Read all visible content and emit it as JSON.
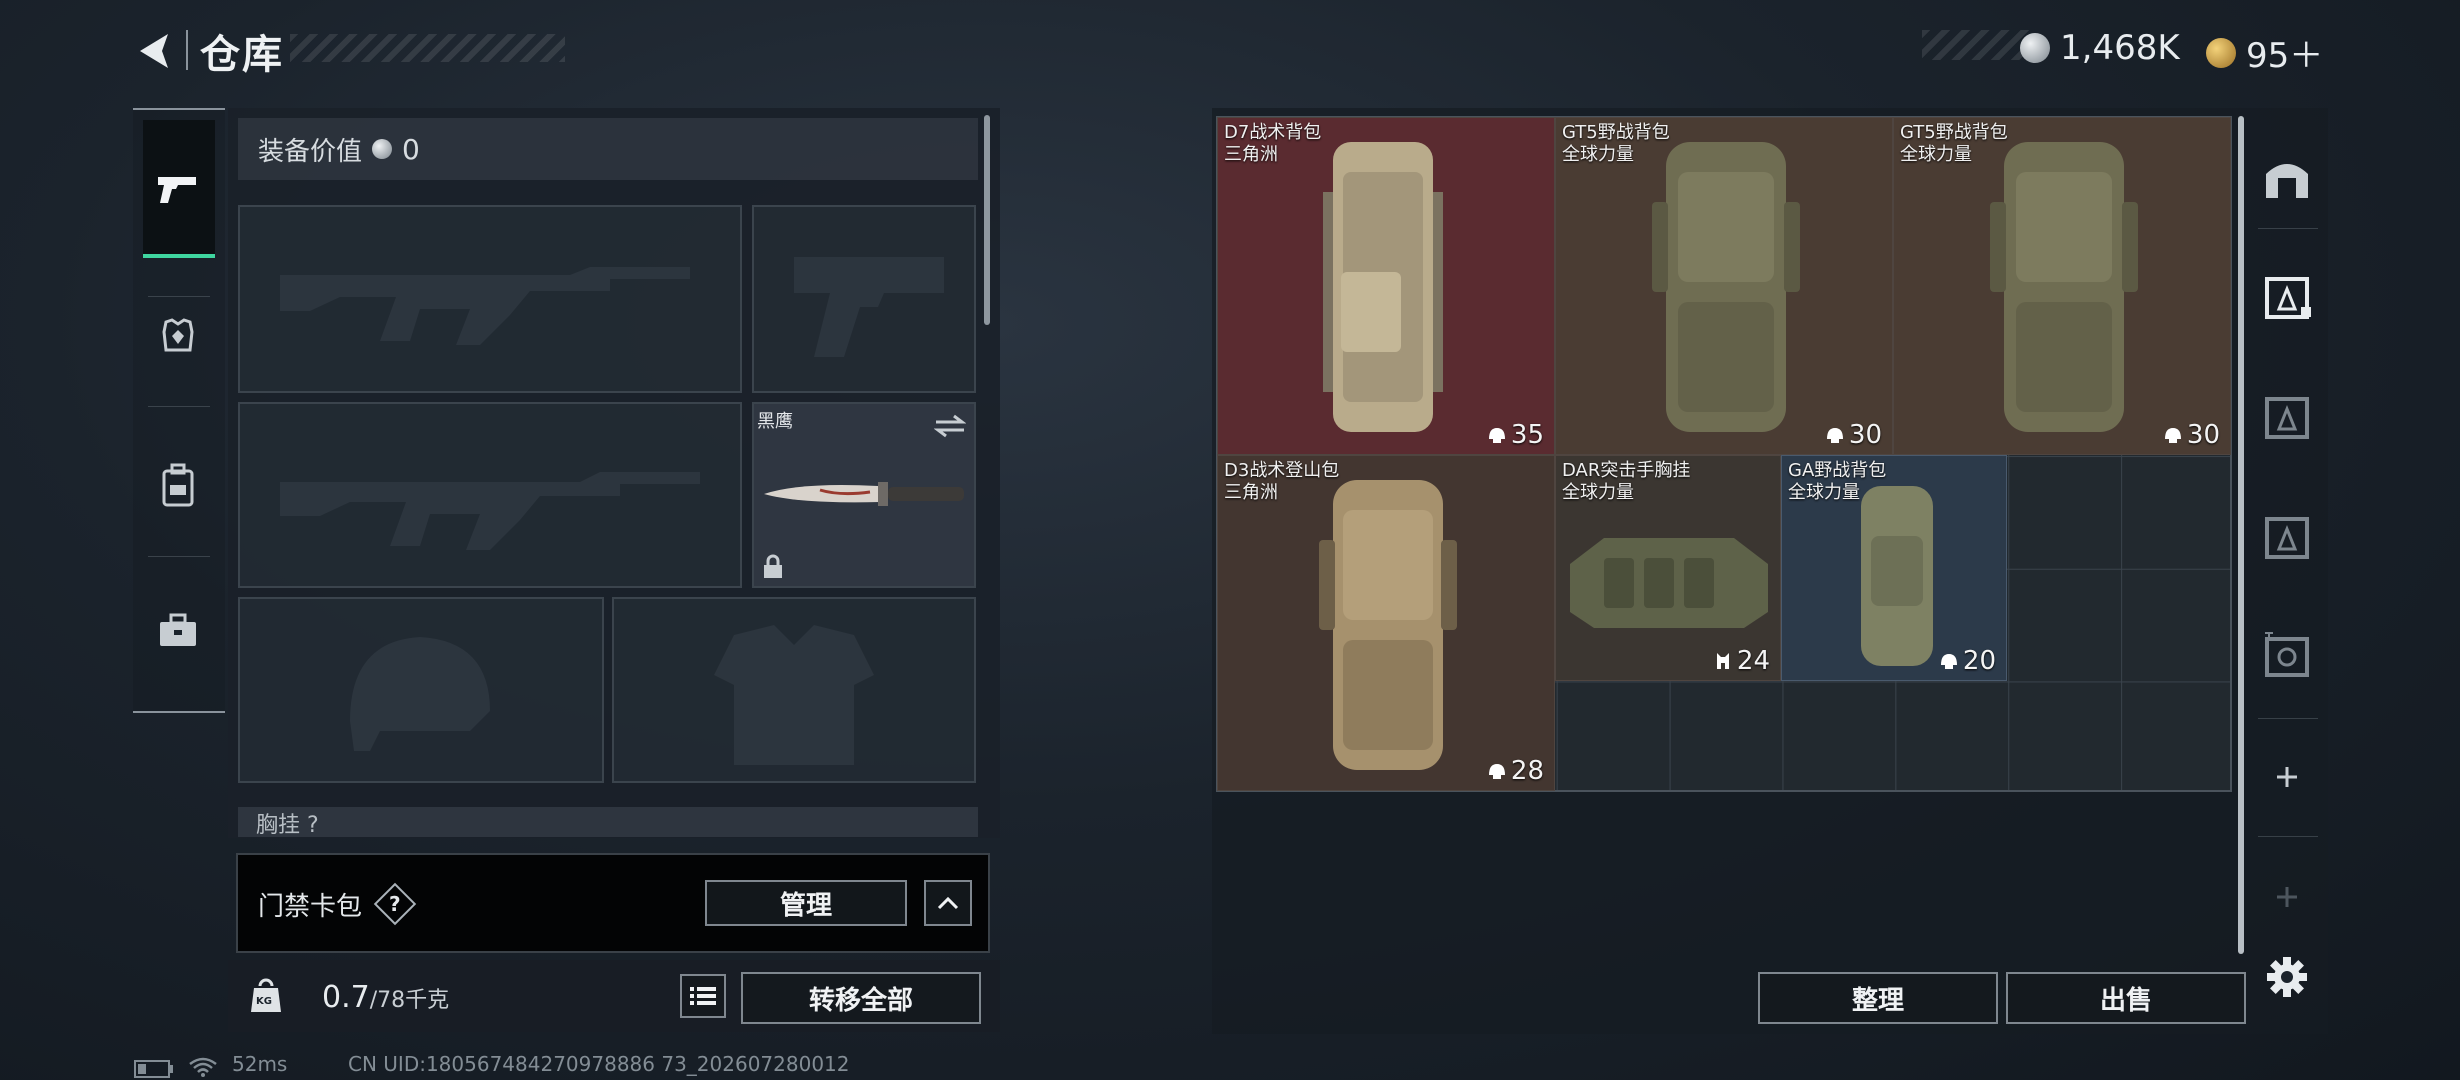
{
  "header": {
    "title": "仓库"
  },
  "currency": {
    "primary": "1,468K",
    "secondary": "95＋",
    "primary_color": "#bfc6cc",
    "secondary_color": "#d8a84a"
  },
  "left_tabs": [
    {
      "icon": "pistol-icon",
      "active": true
    },
    {
      "icon": "armor-icon",
      "active": false
    },
    {
      "icon": "backpack-icon",
      "active": false
    },
    {
      "icon": "briefcase-icon",
      "active": false
    }
  ],
  "equipment": {
    "value_label": "装备价值",
    "value": "0",
    "knife_name": "黑鹰",
    "partial_row_label": "胸挂 ?",
    "card_bag_label": "门禁卡包",
    "card_bag_help": "?",
    "manage_button": "管理"
  },
  "carry": {
    "weight_value": "0.7",
    "weight_max": "/78千克",
    "kg_icon_text": "KG",
    "transfer_all": "转移全部"
  },
  "storage": {
    "items": [
      {
        "name": "D7战术背包",
        "source": "三角洲",
        "capacity": "35",
        "cap_icon": "helmet-icon",
        "color": "#5a2b30"
      },
      {
        "name": "GT5野战背包",
        "source": "全球力量",
        "capacity": "30",
        "cap_icon": "helmet-icon",
        "color": "#4a3c33"
      },
      {
        "name": "GT5野战背包",
        "source": "全球力量",
        "capacity": "30",
        "cap_icon": "helmet-icon",
        "color": "#4a3c33"
      },
      {
        "name": "D3战术登山包",
        "source": "三角洲",
        "capacity": "28",
        "cap_icon": "helmet-icon",
        "color": "#433630"
      },
      {
        "name": "DAR突击手胸挂",
        "source": "全球力量",
        "capacity": "24",
        "cap_icon": "vest-icon",
        "color": "#3b3631"
      },
      {
        "name": "GA野战背包",
        "source": "全球力量",
        "capacity": "20",
        "cap_icon": "helmet-icon",
        "color": "#2c3a4a"
      }
    ],
    "sort_button": "整理",
    "sell_button": "出售"
  },
  "status_bar": {
    "ping": "52ms",
    "uid": "CN UID:180567484270978886 73_202607280012"
  }
}
